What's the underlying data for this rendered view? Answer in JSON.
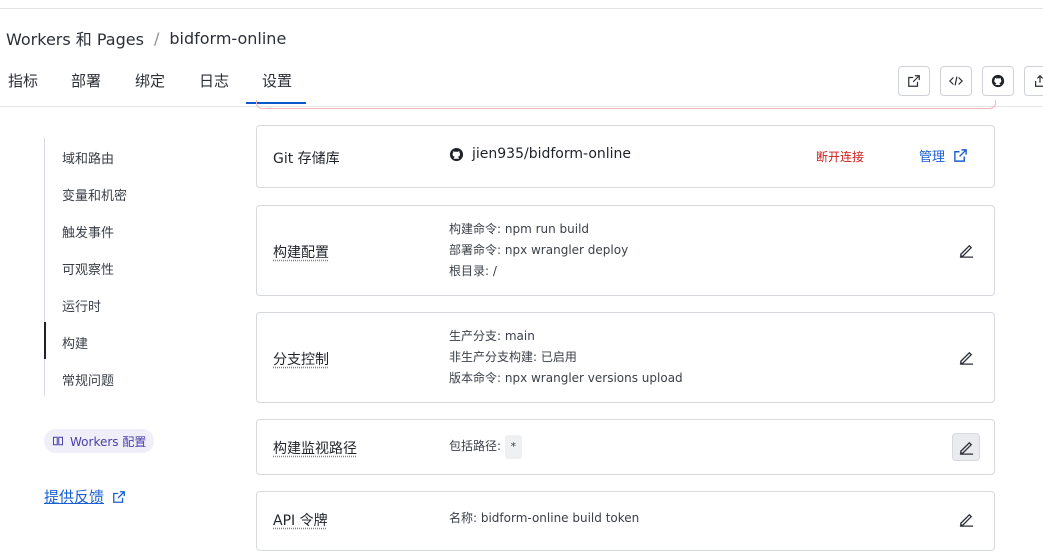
{
  "breadcrumb": {
    "root": "Workers 和 Pages",
    "separator": "/",
    "current": "bidform-online"
  },
  "tabs": [
    "指标",
    "部署",
    "绑定",
    "日志",
    "设置"
  ],
  "active_tab": "设置",
  "toolbar": {
    "icons": [
      "external-link-icon",
      "code-icon",
      "github-icon",
      "share-icon"
    ]
  },
  "sidebar": {
    "items": [
      "域和路由",
      "变量和机密",
      "触发事件",
      "可观察性",
      "运行时",
      "构建",
      "常规问题"
    ],
    "active": "构建"
  },
  "workers_pill": {
    "label": "Workers 配置",
    "icon": "book-icon"
  },
  "feedback": {
    "label": "提供反馈"
  },
  "git_card": {
    "label": "Git 存储库",
    "repo": "jien935/bidform-online",
    "disconnect": "断开连接",
    "manage": "管理"
  },
  "build_card": {
    "label": "构建配置",
    "lines": [
      "构建命令: npm run build",
      "部署命令: npx wrangler deploy",
      "根目录: /"
    ]
  },
  "branch_card": {
    "label": "分支控制",
    "lines": [
      "生产分支: main",
      "非生产分支构建: 已启用",
      "版本命令: npx wrangler versions upload"
    ]
  },
  "watch_card": {
    "label": "构建监视路径",
    "prefix": "包括路径:",
    "value": "*"
  },
  "api_card": {
    "label": "API 令牌",
    "lines": [
      "名称: bidform-online build token"
    ]
  },
  "colors": {
    "accent": "#0a58ca",
    "danger": "#d11d1d",
    "link": "#1a5fd0"
  }
}
